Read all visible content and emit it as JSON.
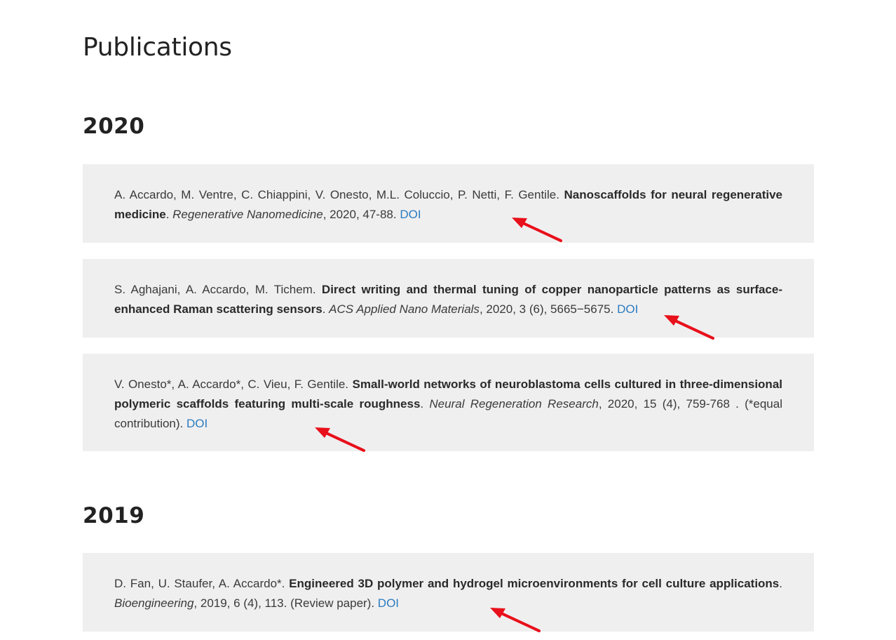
{
  "page": {
    "title": "Publications"
  },
  "sections": [
    {
      "year": "2020",
      "publications": [
        {
          "authors": "A. Accardo, M. Ventre, C. Chiappini, V. Onesto, M.L. Coluccio, P. Netti, F. Gentile. ",
          "title": "Nanoscaffolds for neural regenerative medicine",
          "sep": ". ",
          "journal": "Regenerative Nanomedicine",
          "details": ", 2020, 47-88. ",
          "doi_label": "DOI"
        },
        {
          "authors": "S. Aghajani, A. Accardo, M. Tichem. ",
          "title": "Direct writing and thermal tuning of copper nanoparticle patterns as surface-enhanced Raman scattering sensors",
          "sep": ". ",
          "journal": "ACS Applied Nano Materials",
          "details": ", 2020, 3 (6), 5665−5675. ",
          "doi_label": "DOI"
        },
        {
          "authors": "V. Onesto*, A. Accardo*, C. Vieu, F. Gentile. ",
          "title": "Small-world networks of neuroblastoma cells cultured in three-dimensional polymeric scaffolds featuring multi-scale roughness",
          "sep": ". ",
          "journal": "Neural Regeneration Research",
          "details": ", 2020, 15 (4), 759-768 . (*equal contribution). ",
          "doi_label": "DOI"
        }
      ]
    },
    {
      "year": "2019",
      "publications": [
        {
          "authors": "D. Fan, U. Staufer, A. Accardo*. ",
          "title": "Engineered 3D polymer and hydrogel microenvironments for cell culture applications",
          "sep": ". ",
          "journal": "Bioengineering",
          "details": ", 2019, 6 (4), 113. (Review paper). ",
          "doi_label": "DOI"
        }
      ]
    }
  ],
  "colors": {
    "card_background": "#f0eff0",
    "link": "#2b7bbf",
    "annotation_arrow": "#e8101a"
  },
  "icons": {
    "annotation": "red-arrow-icon"
  }
}
